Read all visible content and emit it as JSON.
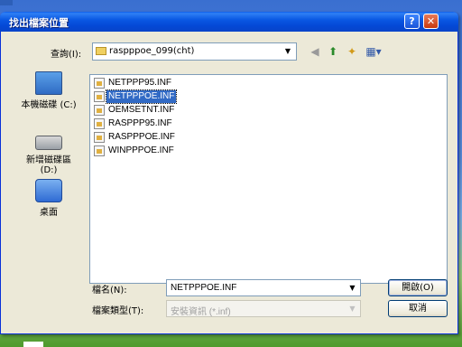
{
  "window": {
    "title": "找出檔案位置",
    "help_glyph": "?",
    "close_glyph": "✕"
  },
  "lookin": {
    "label": "查詢(I):",
    "value": "raspppoe_099(cht)"
  },
  "toolbar": {
    "back_icon": "back-icon",
    "up_icon": "up-folder-icon",
    "new_folder_icon": "new-folder-icon",
    "views_icon": "views-menu-icon"
  },
  "places": [
    {
      "label": "本機磁碟 (C:)",
      "icon": "local-disk-icon"
    },
    {
      "label": "新增磁碟區\n(D:)",
      "icon": "drive-icon"
    },
    {
      "label": "桌面",
      "icon": "desktop-icon"
    }
  ],
  "files": [
    {
      "name": "NETPPP95.INF",
      "selected": false
    },
    {
      "name": "NETPPPOE.INF",
      "selected": true
    },
    {
      "name": "OEMSETNT.INF",
      "selected": false
    },
    {
      "name": "RASPPP95.INF",
      "selected": false
    },
    {
      "name": "RASPPPOE.INF",
      "selected": false
    },
    {
      "name": "WINPPPOE.INF",
      "selected": false
    }
  ],
  "filename": {
    "label": "檔名(N):",
    "value": "NETPPPOE.INF"
  },
  "filetype": {
    "label": "檔案類型(T):",
    "value": "安裝資訊 (*.inf)"
  },
  "buttons": {
    "open": "開啟(O)",
    "cancel": "取消"
  }
}
